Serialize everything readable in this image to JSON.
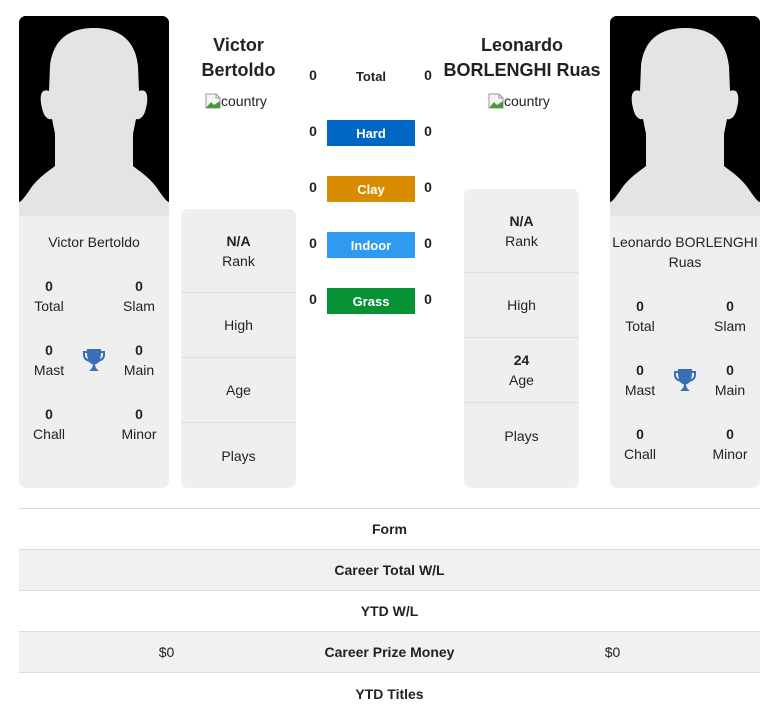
{
  "player1": {
    "name_header": "Victor Bertoldo",
    "name_line1": "Victor",
    "name_line2": "Bertoldo",
    "card_name": "Victor Bertoldo",
    "country_alt": "country",
    "titles": {
      "total": {
        "value": "0",
        "label": "Total"
      },
      "slam": {
        "value": "0",
        "label": "Slam"
      },
      "mast": {
        "value": "0",
        "label": "Mast"
      },
      "main": {
        "value": "0",
        "label": "Main"
      },
      "chall": {
        "value": "0",
        "label": "Chall"
      },
      "minor": {
        "value": "0",
        "label": "Minor"
      }
    },
    "info": {
      "rank": {
        "value": "N/A",
        "label": "Rank"
      },
      "high": {
        "value": "",
        "label": "High"
      },
      "age": {
        "value": "",
        "label": "Age"
      },
      "plays": {
        "value": "",
        "label": "Plays"
      }
    }
  },
  "player2": {
    "name_line1": "Leonardo",
    "name_line2": "BORLENGHI Ruas",
    "card_name": "Leonardo BORLENGHI Ruas",
    "country_alt": "country",
    "titles": {
      "total": {
        "value": "0",
        "label": "Total"
      },
      "slam": {
        "value": "0",
        "label": "Slam"
      },
      "mast": {
        "value": "0",
        "label": "Mast"
      },
      "main": {
        "value": "0",
        "label": "Main"
      },
      "chall": {
        "value": "0",
        "label": "Chall"
      },
      "minor": {
        "value": "0",
        "label": "Minor"
      }
    },
    "info": {
      "rank": {
        "value": "N/A",
        "label": "Rank"
      },
      "high": {
        "value": "",
        "label": "High"
      },
      "age": {
        "value": "24",
        "label": "Age"
      },
      "plays": {
        "value": "",
        "label": "Plays"
      }
    }
  },
  "surfaces": [
    {
      "label": "Total",
      "p1": "0",
      "p2": "0",
      "color": ""
    },
    {
      "label": "Hard",
      "p1": "0",
      "p2": "0",
      "color": "#0068c4"
    },
    {
      "label": "Clay",
      "p1": "0",
      "p2": "0",
      "color": "#d98c00"
    },
    {
      "label": "Indoor",
      "p1": "0",
      "p2": "0",
      "color": "#2e9bf0"
    },
    {
      "label": "Grass",
      "p1": "0",
      "p2": "0",
      "color": "#079235"
    }
  ],
  "table": [
    {
      "label": "Form",
      "p1": "",
      "p2": ""
    },
    {
      "label": "Career Total W/L",
      "p1": "",
      "p2": ""
    },
    {
      "label": "YTD W/L",
      "p1": "",
      "p2": ""
    },
    {
      "label": "Career Prize Money",
      "p1": "$0",
      "p2": "$0"
    },
    {
      "label": "YTD Titles",
      "p1": "",
      "p2": ""
    }
  ],
  "colors": {
    "trophy": "#3a6fb8",
    "card_bg": "#efefef"
  }
}
